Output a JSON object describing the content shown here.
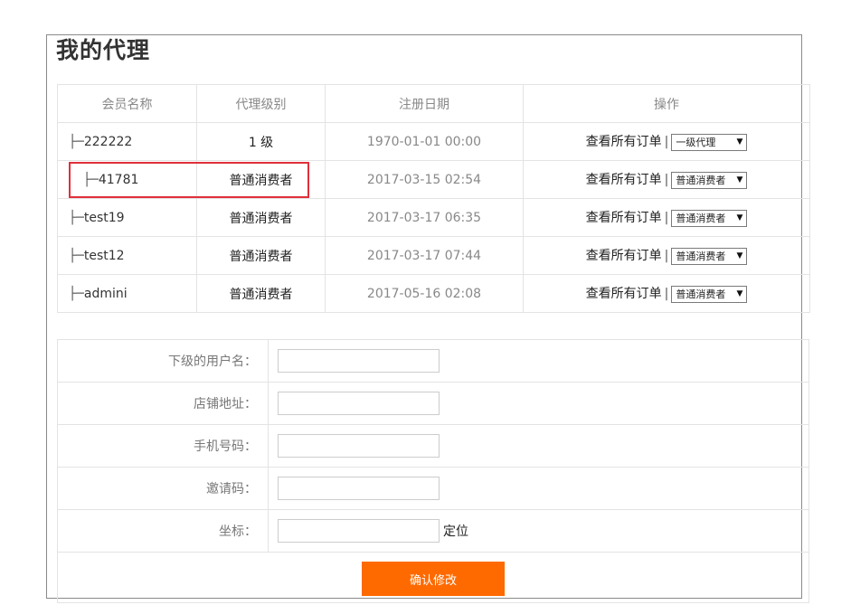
{
  "page": {
    "title": "我的代理"
  },
  "members_table": {
    "headers": [
      "会员名称",
      "代理级别",
      "注册日期",
      "操作"
    ],
    "rows": [
      {
        "tree": "├─",
        "name": "222222",
        "level": "1 级",
        "date": "1970-01-01 00:00",
        "view_all": "查看所有订单",
        "sep": "|",
        "select_value": "一级代理"
      },
      {
        "tree": "├─",
        "name": "41781",
        "level": "普通消费者",
        "date": "2017-03-15 02:54",
        "view_all": "查看所有订单",
        "sep": "|",
        "select_value": "普通消费者"
      },
      {
        "tree": "├─",
        "name": "test19",
        "level": "普通消费者",
        "date": "2017-03-17 06:35",
        "view_all": "查看所有订单",
        "sep": "|",
        "select_value": "普通消费者"
      },
      {
        "tree": "├─",
        "name": "test12",
        "level": "普通消费者",
        "date": "2017-03-17 07:44",
        "view_all": "查看所有订单",
        "sep": "|",
        "select_value": "普通消费者"
      },
      {
        "tree": "├─",
        "name": "admini",
        "level": "普通消费者",
        "date": "2017-05-16 02:08",
        "view_all": "查看所有订单",
        "sep": "|",
        "select_value": "普通消费者"
      }
    ]
  },
  "form": {
    "sub_username_label": "下级的用户名：",
    "sub_username_value": "",
    "shop_address_label": "店铺地址：",
    "shop_address_value": "",
    "phone_label": "手机号码：",
    "phone_value": "",
    "invite_code_label": "邀请码：",
    "invite_code_value": "",
    "coords_label": "坐标：",
    "coords_value": "",
    "locate_label": "定位",
    "submit_label": "确认修改"
  },
  "colors": {
    "accent": "#ff6a00",
    "highlight_box": "#e0303a",
    "border": "#e3e3e3"
  },
  "icons": {
    "select_arrow": "▼"
  }
}
